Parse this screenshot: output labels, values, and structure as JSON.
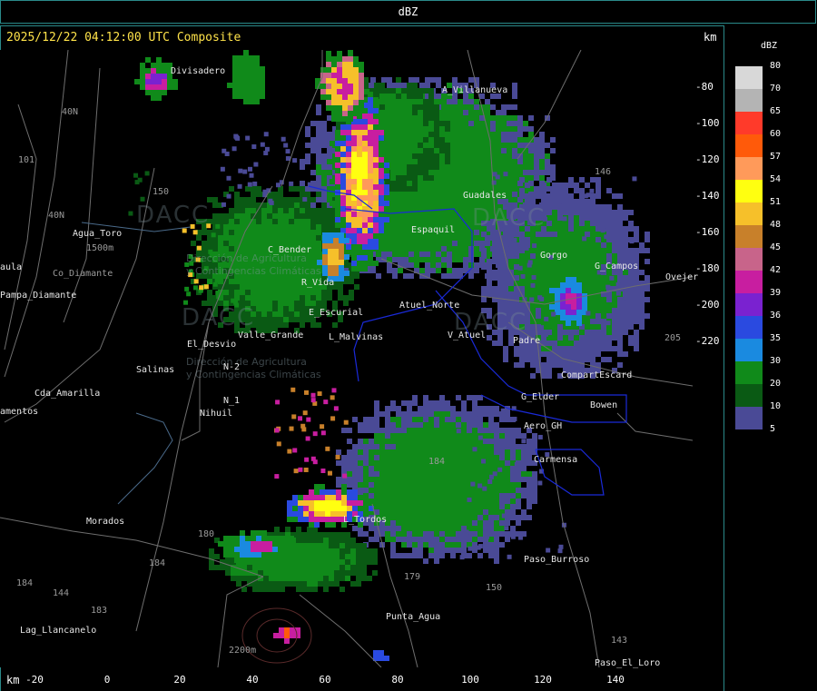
{
  "window": {
    "title": "dBZ"
  },
  "header": {
    "timestamp": "2025/12/22 04:12:00 UTC Composite",
    "unit_top": "km",
    "unit_bottom": "km"
  },
  "legend": {
    "title": "dBZ",
    "levels": [
      {
        "label": "80",
        "color": "#d8d8d8"
      },
      {
        "label": "70",
        "color": "#b4b4b4"
      },
      {
        "label": "65",
        "color": "#ff3a2a"
      },
      {
        "label": "60",
        "color": "#ff5a0a"
      },
      {
        "label": "57",
        "color": "#ff9a5a"
      },
      {
        "label": "54",
        "color": "#ffff10"
      },
      {
        "label": "51",
        "color": "#f6c02a"
      },
      {
        "label": "48",
        "color": "#c8802a"
      },
      {
        "label": "45",
        "color": "#c8648a"
      },
      {
        "label": "42",
        "color": "#c81ea0"
      },
      {
        "label": "39",
        "color": "#7a22d0"
      },
      {
        "label": "36",
        "color": "#2a4ae0"
      },
      {
        "label": "35",
        "color": "#1a8ae0"
      },
      {
        "label": "30",
        "color": "#108a1a"
      },
      {
        "label": "20",
        "color": "#0a5a14"
      },
      {
        "label": "10",
        "color": "#4a4a96"
      },
      {
        "label": "5",
        "color": ""
      }
    ]
  },
  "axes": {
    "y_ticks": [
      "-80",
      "-100",
      "-120",
      "-140",
      "-160",
      "-180",
      "-200",
      "-220"
    ],
    "x_ticks": [
      "-20",
      "0",
      "20",
      "40",
      "60",
      "80",
      "100",
      "120",
      "140"
    ]
  },
  "watermark": {
    "brand": "DACC",
    "line1": "Dirección de Agricultura",
    "line2": "y Contingencias Climáticas"
  },
  "places": [
    {
      "t": "Divisadero",
      "dim": false
    },
    {
      "t": "A_Villanueva",
      "dim": false
    },
    {
      "t": "40N",
      "dim": true
    },
    {
      "t": "101",
      "dim": true
    },
    {
      "t": "150",
      "dim": true
    },
    {
      "t": "40N",
      "dim": true
    },
    {
      "t": "Agua_Toro",
      "dim": false
    },
    {
      "t": "1500m",
      "dim": true
    },
    {
      "t": "aula",
      "dim": false
    },
    {
      "t": "Co_Diamante",
      "dim": true
    },
    {
      "t": "Pampa_Diamante",
      "dim": false
    },
    {
      "t": "Guadales",
      "dim": false
    },
    {
      "t": "146",
      "dim": true
    },
    {
      "t": "Espaquil",
      "dim": false
    },
    {
      "t": "Gorgo",
      "dim": false
    },
    {
      "t": "G_Campos",
      "dim": false
    },
    {
      "t": "Ovejer",
      "dim": false
    },
    {
      "t": "C_Bender",
      "dim": false
    },
    {
      "t": "R_Vida",
      "dim": false
    },
    {
      "t": "Atuel_Norte",
      "dim": false
    },
    {
      "t": "E_Escurial",
      "dim": false
    },
    {
      "t": "Valle_Grande",
      "dim": false
    },
    {
      "t": "El_Desvio",
      "dim": false
    },
    {
      "t": "L_Malvinas",
      "dim": false
    },
    {
      "t": "V_Atuel",
      "dim": false
    },
    {
      "t": "Padre",
      "dim": false
    },
    {
      "t": "Salinas",
      "dim": false
    },
    {
      "t": "N-2",
      "dim": false
    },
    {
      "t": "CompartEscard",
      "dim": false
    },
    {
      "t": "Cda_Amarilla",
      "dim": false
    },
    {
      "t": "N_1",
      "dim": false
    },
    {
      "t": "Nihuil",
      "dim": false
    },
    {
      "t": "G_Elder",
      "dim": false
    },
    {
      "t": "Bowen",
      "dim": false
    },
    {
      "t": "amentos",
      "dim": false
    },
    {
      "t": "Aero_GH",
      "dim": false
    },
    {
      "t": "205",
      "dim": true
    },
    {
      "t": "Carmensa",
      "dim": false
    },
    {
      "t": "184",
      "dim": true
    },
    {
      "t": "Morados",
      "dim": false
    },
    {
      "t": "L_Tordos",
      "dim": false
    },
    {
      "t": "180",
      "dim": true
    },
    {
      "t": "184",
      "dim": true
    },
    {
      "t": "Paso_Burroso",
      "dim": false
    },
    {
      "t": "179",
      "dim": true
    },
    {
      "t": "150",
      "dim": true
    },
    {
      "t": "184",
      "dim": true
    },
    {
      "t": "183",
      "dim": true
    },
    {
      "t": "Punta_Agua",
      "dim": false
    },
    {
      "t": "Lag_Llancanelo",
      "dim": false
    },
    {
      "t": "2200m",
      "dim": true
    },
    {
      "t": "143",
      "dim": true
    },
    {
      "t": "Paso_El_Loro",
      "dim": false
    },
    {
      "t": "144",
      "dim": true
    }
  ],
  "colors": {
    "frame": "#2a8a8a",
    "title": "#ffe34a",
    "roads": "#7a7a7a",
    "basins": "#1a2ad8"
  }
}
